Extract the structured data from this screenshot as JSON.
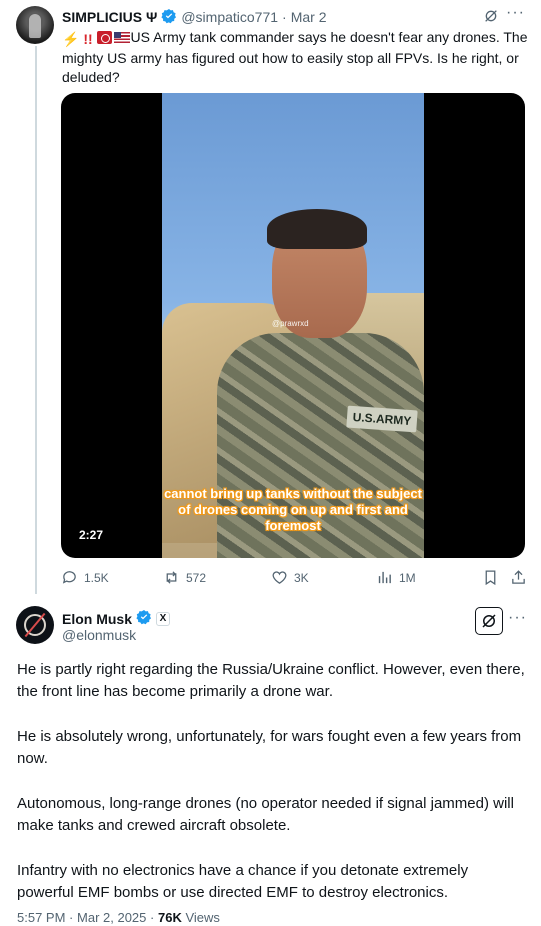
{
  "quoted_tweet": {
    "author_name": "SIMPLICIUS Ψ",
    "handle": "@simpatico771",
    "separator": "·",
    "date": "Mar 2",
    "text_prefix_emoji": "⚡‼️",
    "text": "US Army tank commander says he doesn't fear any drones. The mighty US army has figured out how to easily stop all FPVs. Is he right, or deluded?",
    "video": {
      "duration": "2:27",
      "watermark": "@prawrxd",
      "nametape": "U.S.ARMY",
      "caption": "cannot bring up tanks without the subject of drones coming on up and first and foremost"
    },
    "actions": {
      "replies": "1.5K",
      "reposts": "572",
      "likes": "3K",
      "views": "1M"
    }
  },
  "main_tweet": {
    "author_name": "Elon Musk",
    "badge_x": "X",
    "handle": "@elonmusk",
    "paragraphs": [
      "He is partly right regarding the Russia/Ukraine conflict. However, even there, the front line has become primarily a drone war.",
      "He is absolutely wrong, unfortunately, for wars fought even a few years from now.",
      "Autonomous, long-range drones (no operator needed if signal jammed) will make tanks and crewed aircraft obsolete.",
      "Infantry with no electronics have a chance if you detonate extremely powerful EMF bombs or use directed EMF to destroy electronics."
    ],
    "time": "5:57 PM",
    "date": "Mar 2, 2025",
    "separator": "·",
    "views_count": "76K",
    "views_label": "Views"
  },
  "colors": {
    "verified": "#1d9bf0",
    "secondary_text": "#536471",
    "caption_outline": "#f29a1a"
  }
}
